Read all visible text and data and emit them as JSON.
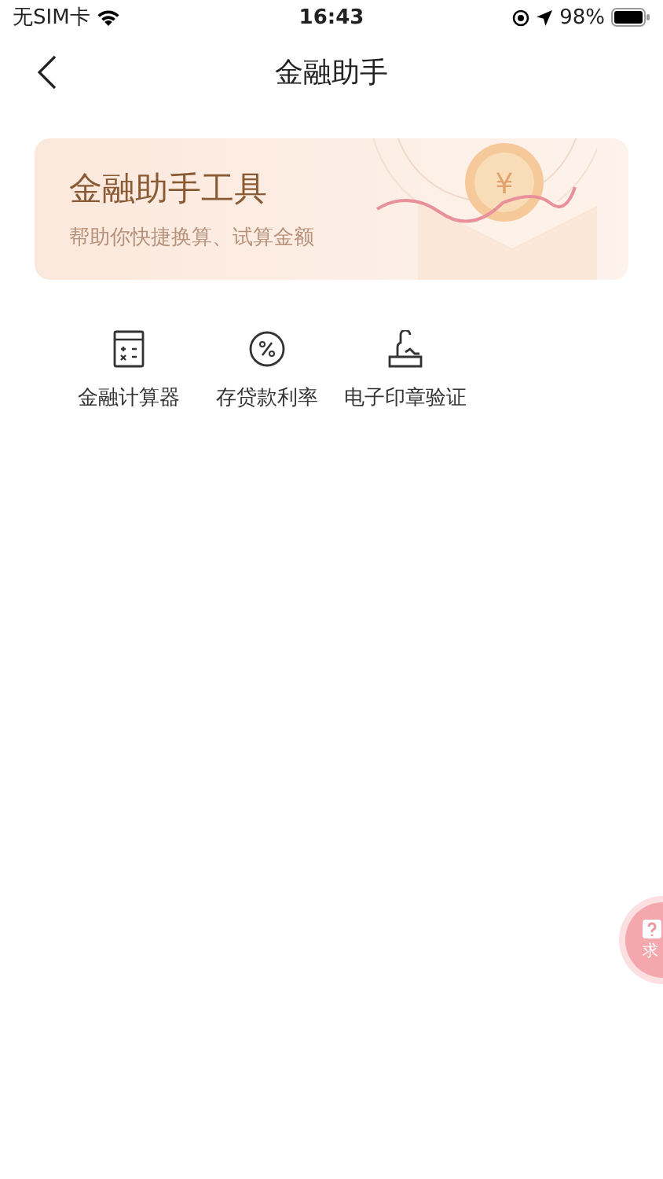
{
  "status_bar": {
    "carrier": "无SIM卡",
    "time": "16:43",
    "battery": "98%"
  },
  "nav": {
    "title": "金融助手"
  },
  "banner": {
    "title": "金融助手工具",
    "subtitle": "帮助你快捷换算、试算金额",
    "coin_symbol": "¥"
  },
  "tools": [
    {
      "kind": "calculator",
      "label": "金融计算器"
    },
    {
      "kind": "rate",
      "label": "存贷款利率"
    },
    {
      "kind": "seal",
      "label": "电子印章验证"
    }
  ],
  "float_button": {
    "label": "求"
  }
}
